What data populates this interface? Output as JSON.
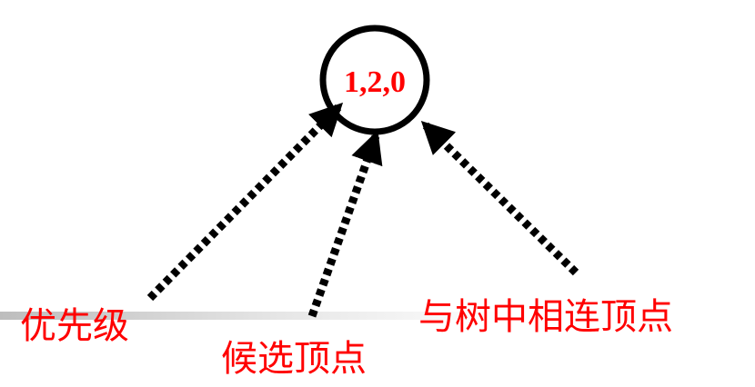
{
  "node": {
    "text": "1,2,0"
  },
  "labels": {
    "priority": "优先级",
    "candidate": "候选顶点",
    "connected": "与树中相连顶点"
  },
  "colors": {
    "text": "#ff0000",
    "stroke": "#000000",
    "baseline_gradient_start": "#bdbdbd"
  }
}
